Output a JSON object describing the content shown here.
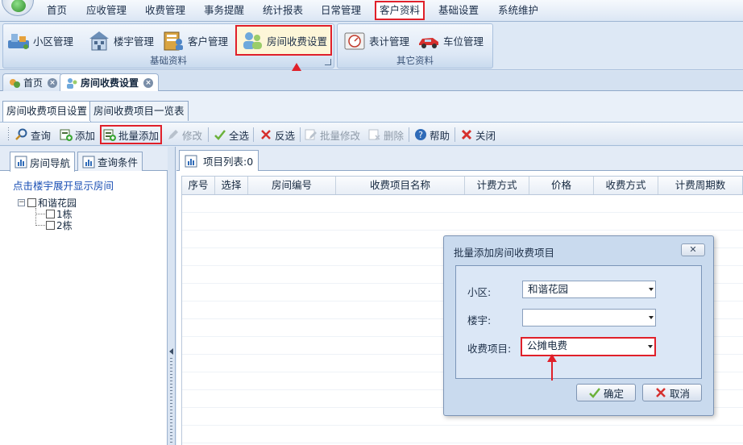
{
  "menu": {
    "items": [
      "首页",
      "应收管理",
      "收费管理",
      "事务提醒",
      "统计报表",
      "日常管理",
      "客户资料",
      "基础设置",
      "系统维护"
    ],
    "active_index": 6
  },
  "ribbon": {
    "basic_group": {
      "title": "基础资料",
      "buttons": [
        "小区管理",
        "楼宇管理",
        "客户管理",
        "房间收费设置"
      ]
    },
    "other_group": {
      "title": "其它资料",
      "buttons": [
        "表计管理",
        "车位管理"
      ]
    }
  },
  "doc_tabs": [
    "首页",
    "房间收费设置"
  ],
  "sub_tabs": [
    "房间收费项目设置",
    "房间收费项目一览表"
  ],
  "toolbar": {
    "query": "查询",
    "add": "添加",
    "batch_add": "批量添加",
    "edit": "修改",
    "select_all": "全选",
    "invert": "反选",
    "batch_edit": "批量修改",
    "delete": "删除",
    "help": "帮助",
    "close": "关闭"
  },
  "left_panel": {
    "tabs": [
      "房间导航",
      "查询条件"
    ],
    "hint": "点击楼宇展开显示房间",
    "tree": {
      "expand_symbol": "−",
      "root": "和谐花园",
      "children": [
        "1栋",
        "2栋"
      ]
    }
  },
  "right_panel": {
    "tab_label": "项目列表:0",
    "columns": [
      "序号",
      "选择",
      "房间编号",
      "收费项目名称",
      "计费方式",
      "价格",
      "收费方式",
      "计费周期数"
    ]
  },
  "dialog": {
    "title": "批量添加房间收费项目",
    "close_symbol": "✕",
    "fields": {
      "community": {
        "label": "小区:",
        "value": "和谐花园"
      },
      "building": {
        "label": "楼宇:",
        "value": ""
      },
      "fee_item": {
        "label": "收费项目:",
        "value": "公摊电费"
      }
    },
    "ok": "确定",
    "cancel": "取消"
  },
  "colors": {
    "highlight": "#e0202a",
    "link": "#1a4fb4",
    "accent": "#15283f"
  }
}
